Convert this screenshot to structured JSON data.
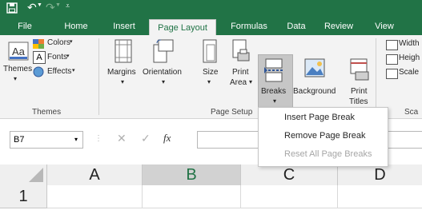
{
  "tabs": [
    {
      "label": "File"
    },
    {
      "label": "Home"
    },
    {
      "label": "Insert"
    },
    {
      "label": "Page Layout"
    },
    {
      "label": "Formulas"
    },
    {
      "label": "Data"
    },
    {
      "label": "Review"
    },
    {
      "label": "View"
    }
  ],
  "ribbon": {
    "themes": {
      "label": "Themes",
      "colors": "Colors",
      "fonts": "Fonts",
      "effects": "Effects"
    },
    "margins": "Margins",
    "orientation": "Orientation",
    "size": "Size",
    "print_area_1": "Print",
    "print_area_2": "Area",
    "breaks": "Breaks",
    "background": "Background",
    "print_titles_1": "Print",
    "print_titles_2": "Titles",
    "width": "Width",
    "height": "Heigh",
    "scale": "Scale",
    "group_themes": "Themes",
    "group_page_setup": "Page Setup",
    "group_scale": "Sca"
  },
  "name_box": "B7",
  "fx": "fx",
  "columns": [
    "A",
    "B",
    "C",
    "D"
  ],
  "rows": [
    "1"
  ],
  "breaks_menu": {
    "insert": "Insert Page Break",
    "remove": "Remove Page Break",
    "reset": "Reset All Page Breaks"
  },
  "colors": {
    "accent": "#217346"
  }
}
